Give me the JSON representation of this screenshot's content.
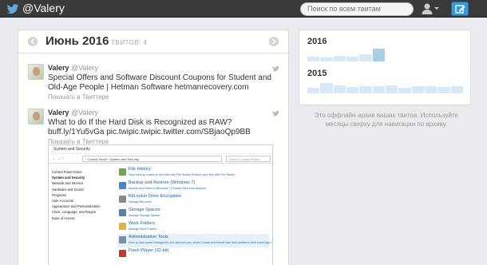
{
  "header": {
    "handle": "@Valery",
    "search_placeholder": "Поиск по всем твитам",
    "icons": {
      "logo": "twitter-bird-icon",
      "user": "user-icon",
      "compose": "compose-icon"
    },
    "accent_color": "#3a9ad9"
  },
  "timeline": {
    "month_title": "Июнь 2016",
    "tweet_count_label": "ТВИТОВ: 4",
    "tweets": [
      {
        "name": "Valery",
        "handle": "@Valery",
        "text": "Special Offers and Software Discount Coupons for Student and Old-Age People | Hetman Software",
        "link": "hetmanrecovery.com",
        "view_label": "Показать в Твиттере"
      },
      {
        "name": "Valery",
        "handle": "@Valery",
        "text": "What to do If the Hard Disk is Recognized as RAW?",
        "link": "buff.ly/1Yu5vGa pic.twipic.twipic.twitter.com/SBjaoQp9BB",
        "view_label": "Показать в Твиттере"
      }
    ],
    "attached_screenshot": {
      "window_title": "System and Security",
      "breadcrumb": "›  Control Panel  ›  System and Security",
      "search_text": "Search Control Panel",
      "sidebar": [
        "Control Panel Home",
        "System and Security",
        "Network and Internet",
        "Hardware and Sound",
        "Programs",
        "User Accounts",
        "Appearance and Personalization",
        "Clock, Language, and Region",
        "Ease of Access"
      ],
      "items": [
        {
          "title": "File History",
          "sub": "Save backup copies of your files with File History    Restore your files with File History",
          "color": "#6aa84f"
        },
        {
          "title": "Backup and Restore (Windows 7)",
          "sub": "Backup and Restore (Windows 7)    Restore files from backups",
          "color": "#4a86c5"
        },
        {
          "title": "BitLocker Drive Encryption",
          "sub": "Manage BitLocker",
          "color": "#8a8a8a"
        },
        {
          "title": "Storage Spaces",
          "sub": "Manage Storage Spaces",
          "color": "#5b7fa8"
        },
        {
          "title": "Work Folders",
          "sub": "Manage Work Folders",
          "color": "#e3b341"
        },
        {
          "title": "Administrative Tools",
          "sub": "Free up disk space    Defragment and optimize your drives    Create and format hard disk partitions    View event logs    Schedule tasks",
          "color": "#7a8fa6"
        },
        {
          "title": "Flash Player (32-bit)",
          "sub": "",
          "color": "#c0392b"
        }
      ]
    }
  },
  "archive": {
    "years": [
      {
        "year": "2016",
        "months": [
          0.35,
          0.3,
          0.4,
          0.35,
          0.55,
          0.95,
          0,
          0,
          0,
          0,
          0,
          0
        ],
        "active_month": 5
      },
      {
        "year": "2015",
        "months": [
          0.4,
          0.75,
          0.6,
          0.45,
          0.55,
          0.5,
          0.6,
          0.4,
          0.55,
          0.5,
          0.45,
          0.5
        ]
      }
    ],
    "caption": "Это оффлайн-архив ваших твитов. Используйте месяцы сверху для навигации по архиву."
  }
}
